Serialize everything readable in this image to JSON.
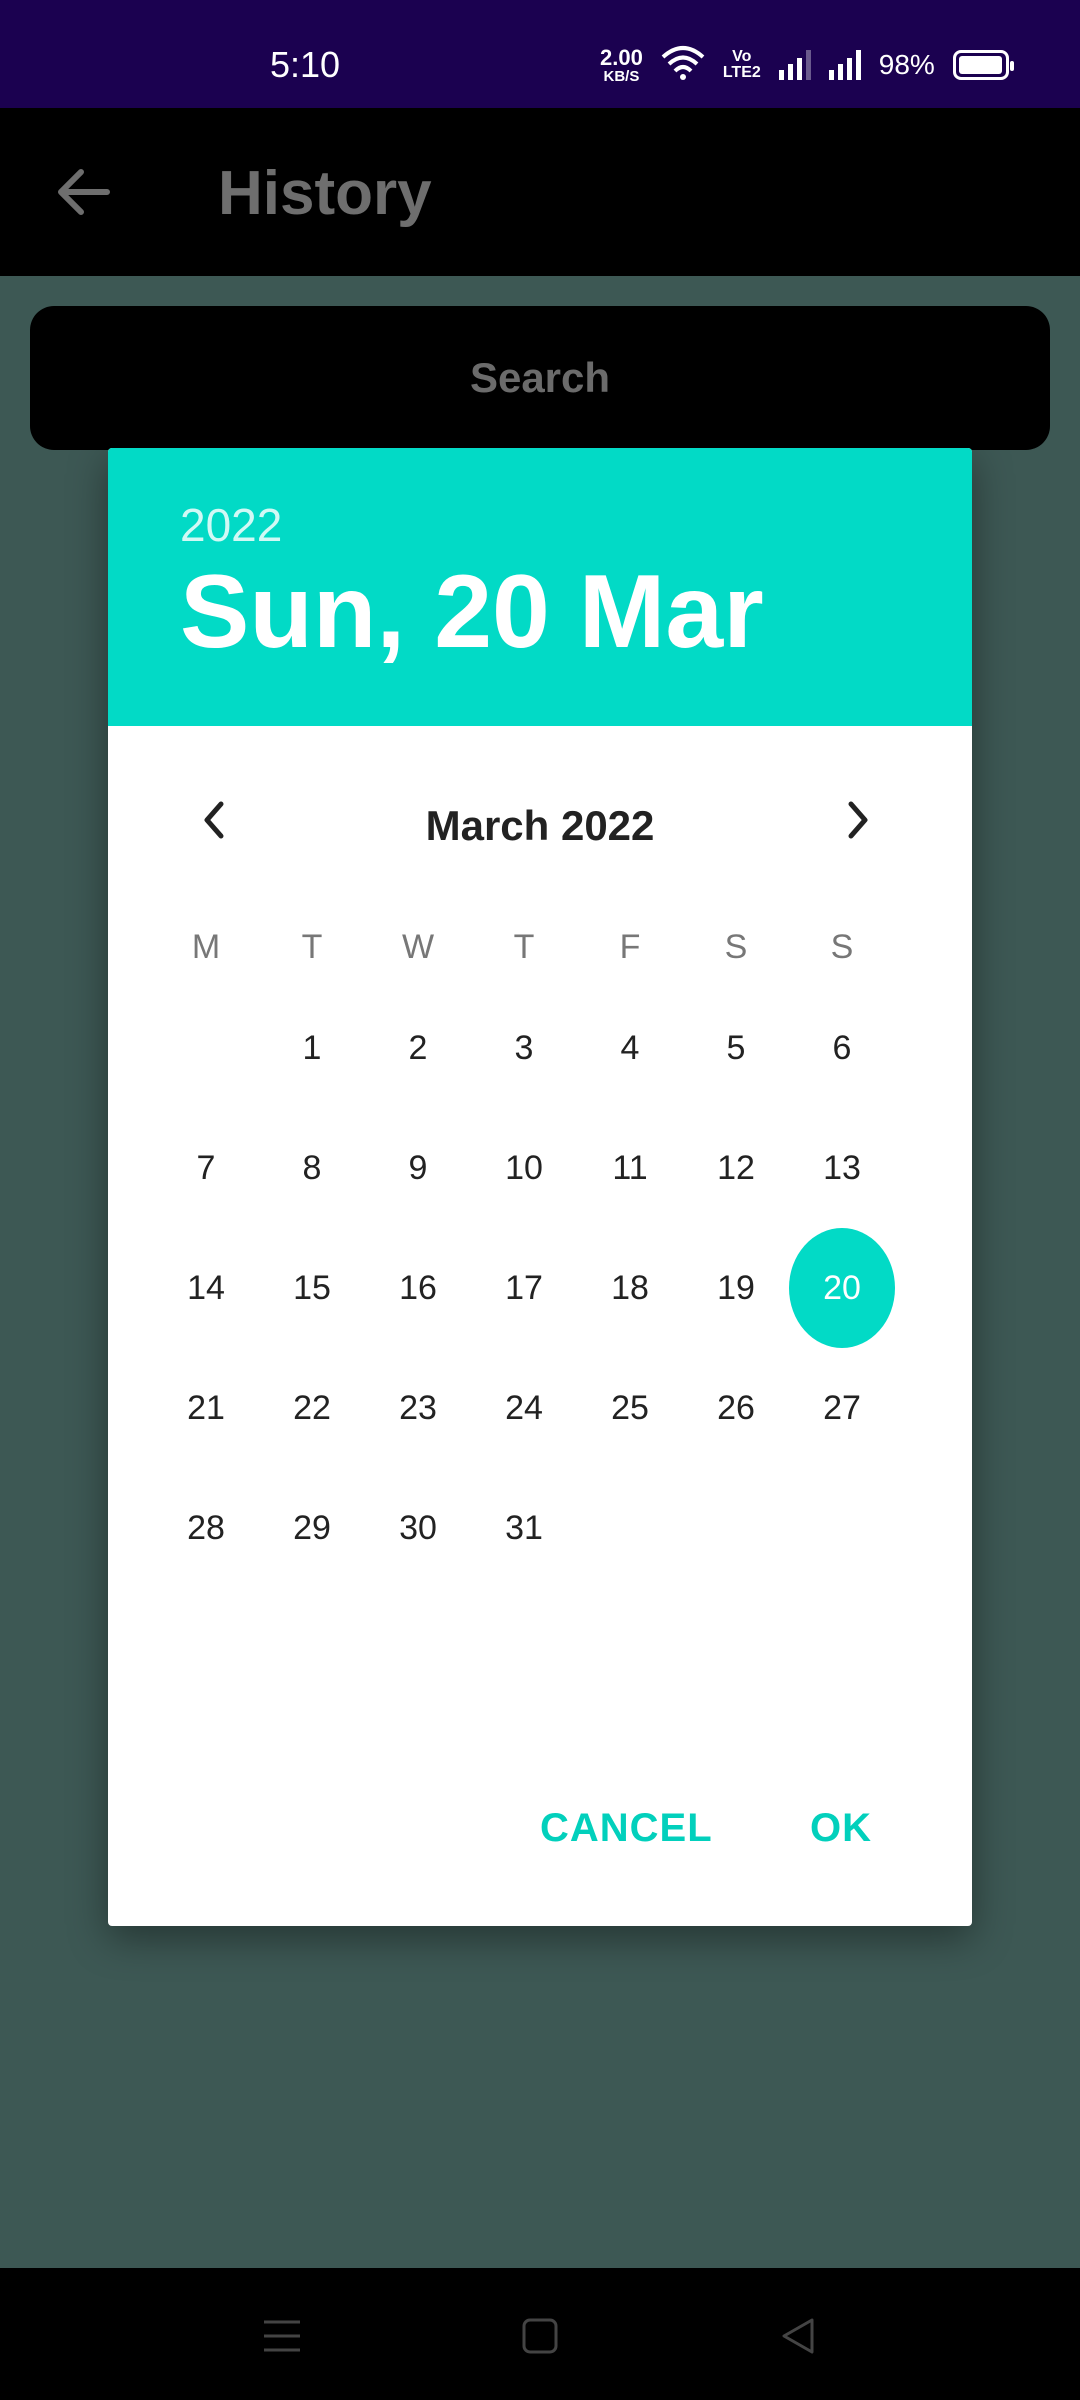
{
  "status_bar": {
    "time": "5:10",
    "net_speed_value": "2.00",
    "net_speed_unit": "KB/S",
    "volte_top": "Vo",
    "volte_bottom": "LTE2",
    "battery": "98%",
    "battery_level": 0.98
  },
  "app_bar": {
    "title": "History",
    "back_icon": "arrow-left-icon"
  },
  "search": {
    "placeholder": "Search"
  },
  "date_picker": {
    "year": "2022",
    "selected_date_label": "Sun, 20 Mar",
    "month_label": "March 2022",
    "weekdays": [
      "M",
      "T",
      "W",
      "T",
      "F",
      "S",
      "S"
    ],
    "first_weekday_offset": 1,
    "days": [
      "1",
      "2",
      "3",
      "4",
      "5",
      "6",
      "7",
      "8",
      "9",
      "10",
      "11",
      "12",
      "13",
      "14",
      "15",
      "16",
      "17",
      "18",
      "19",
      "20",
      "21",
      "22",
      "23",
      "24",
      "25",
      "26",
      "27",
      "28",
      "29",
      "30",
      "31"
    ],
    "selected_day": "20",
    "cancel_label": "CANCEL",
    "ok_label": "OK",
    "accent_color": "#02dac6"
  },
  "nav_bar": {
    "icons": [
      "menu-icon",
      "home-square-icon",
      "back-triangle-icon"
    ]
  }
}
